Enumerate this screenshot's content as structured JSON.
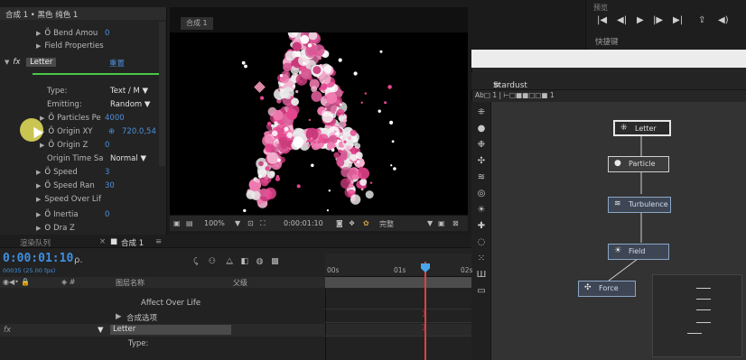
{
  "effect_controls": {
    "header": "合成 1 • 黑色 纯色 1",
    "rows": [
      {
        "label": "Bend Amou",
        "value": "0"
      },
      {
        "label": "Field Properties"
      }
    ],
    "fx_name": "Letter",
    "fx_reset": "重置",
    "params": [
      {
        "label": "Type:",
        "value": "Text / M ▼"
      },
      {
        "label": "Emitting:",
        "value": "Random ▼"
      },
      {
        "label": "Particles Pe",
        "value": "4000"
      },
      {
        "label": "Origin XY",
        "value": "720.0,54"
      },
      {
        "label": "Origin Z",
        "value": "0"
      },
      {
        "label": "Origin Time Sa",
        "value": "Normal ▼"
      },
      {
        "label": "Speed",
        "value": "3"
      },
      {
        "label": "Speed Ran",
        "value": "30"
      },
      {
        "label": "Speed Over Lif"
      },
      {
        "label": "Inertia",
        "value": "0"
      },
      {
        "label": "Dra Z"
      }
    ]
  },
  "viewer": {
    "tab": "合成 1",
    "zoom": "100%",
    "timecode": "0:00:01:10",
    "quality": "完整"
  },
  "preview": {
    "title": "预览",
    "label": "快捷键"
  },
  "stardust": {
    "title": "Stardust",
    "menu_icon": "≡",
    "subtabs": "Ab□ 1  |  ⊢□■■□□■ 1",
    "nodes": [
      {
        "label": "Letter",
        "icon": "text-icon"
      },
      {
        "label": "Particle",
        "icon": "circle-icon"
      },
      {
        "label": "Turbulence",
        "icon": "wave-icon"
      },
      {
        "label": "Field",
        "icon": "field-icon"
      },
      {
        "label": "Force",
        "icon": "force-icon"
      }
    ]
  },
  "timeline": {
    "render_tab": "渲染队列",
    "comp_tab": "合成 1",
    "timecode": "0:00:01:10",
    "fps": "00035 (25.00 fps)",
    "columns": {
      "layer_name": "图层名称",
      "parent": "父级"
    },
    "ruler": [
      "00s",
      "01s",
      "02s"
    ],
    "rows": [
      {
        "label": "Affect Over Life"
      },
      {
        "label": "合成选项"
      },
      {
        "label": "Letter"
      },
      {
        "label": "Type:"
      }
    ]
  }
}
